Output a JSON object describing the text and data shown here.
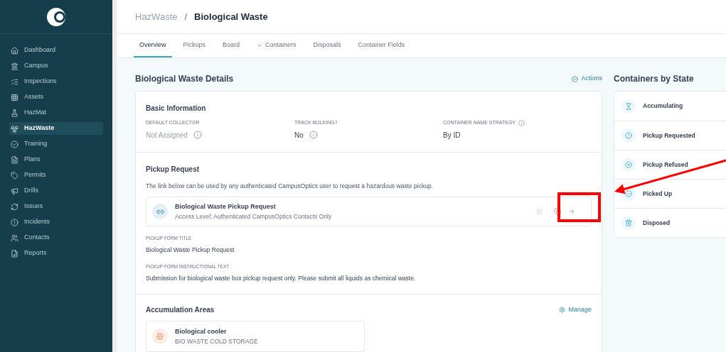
{
  "sidebar": {
    "items": [
      {
        "label": "Dashboard",
        "selected": false
      },
      {
        "label": "Campus",
        "selected": false
      },
      {
        "label": "Inspections",
        "selected": false
      },
      {
        "label": "Assets",
        "selected": false
      },
      {
        "label": "HazMat",
        "selected": false
      },
      {
        "label": "HazWaste",
        "selected": true
      },
      {
        "label": "Training",
        "selected": false
      },
      {
        "label": "Plans",
        "selected": false
      },
      {
        "label": "Permits",
        "selected": false
      },
      {
        "label": "Drills",
        "selected": false
      },
      {
        "label": "Issues",
        "selected": false
      },
      {
        "label": "Incidents",
        "selected": false
      },
      {
        "label": "Contacts",
        "selected": false
      },
      {
        "label": "Reports",
        "selected": false
      }
    ]
  },
  "breadcrumb": {
    "parent": "HazWaste",
    "separator": "/",
    "current": "Biological Waste"
  },
  "tabs": [
    {
      "label": "Overview",
      "selected": true,
      "dropdown": false
    },
    {
      "label": "Pickups",
      "selected": false,
      "dropdown": false
    },
    {
      "label": "Board",
      "selected": false,
      "dropdown": false
    },
    {
      "label": "Containers",
      "selected": false,
      "dropdown": true
    },
    {
      "label": "Disposals",
      "selected": false,
      "dropdown": false
    },
    {
      "label": "Container Fields",
      "selected": false,
      "dropdown": false
    }
  ],
  "details": {
    "title": "Biological Waste Details",
    "actions": "Actions",
    "basic": {
      "title": "Basic Information",
      "fields": [
        {
          "label": "DEFAULT COLLECTOR",
          "value": "Not Assigned",
          "muted": true
        },
        {
          "label": "TRACK BULKING?",
          "value": "No",
          "muted": false
        },
        {
          "label": "CONTAINER NAME STRATEGY",
          "value": "By ID",
          "muted": false
        }
      ]
    },
    "pickup": {
      "title": "Pickup Request",
      "description": "The link below can be used by any authenticated CampusOptics user to request a hazardous waste pickup.",
      "link": {
        "title": "Biological Waste Pickup Request",
        "subtitle": "Access Level: Authenticated CampusOptics Contacts Only"
      },
      "fields": [
        {
          "label": "PICKUP FORM TITLE",
          "value": "Biological Waste Pickup Request"
        },
        {
          "label": "PICKUP FORM INSTRUCTIONAL TEXT",
          "value": "Submission for biological waste box pickup request only. Please submit all liquids as chemical waste."
        }
      ]
    },
    "areas": {
      "title": "Accumulation Areas",
      "manage": "Manage",
      "items": [
        {
          "name": "Biological cooler",
          "subtitle": "BIO WASTE COLD STORAGE"
        }
      ]
    }
  },
  "states": {
    "title": "Containers by State",
    "items": [
      {
        "label": "Accumulating"
      },
      {
        "label": "Pickup Requested"
      },
      {
        "label": "Pickup Refused"
      },
      {
        "label": "Picked Up"
      },
      {
        "label": "Disposed"
      }
    ]
  }
}
